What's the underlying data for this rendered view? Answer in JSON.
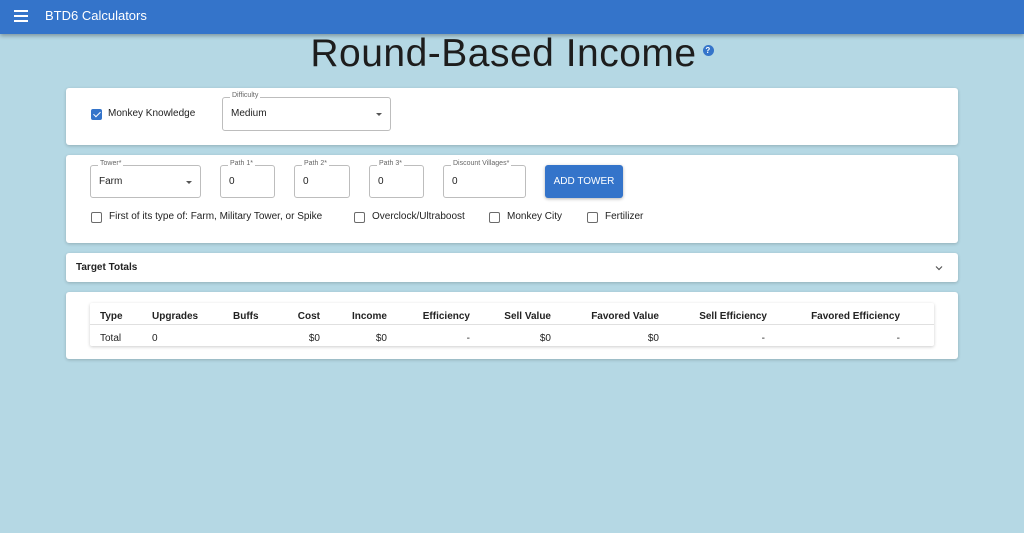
{
  "appbar": {
    "title": "BTD6 Calculators"
  },
  "page": {
    "title": "Round-Based Income",
    "help_icon": "?"
  },
  "settings": {
    "monkey_knowledge": {
      "label": "Monkey Knowledge",
      "checked": true
    },
    "difficulty": {
      "label": "Difficulty",
      "value": "Medium"
    }
  },
  "tower_form": {
    "tower": {
      "label": "Tower",
      "required": "*",
      "value": "Farm"
    },
    "path1": {
      "label": "Path 1",
      "required": "*",
      "value": "0"
    },
    "path2": {
      "label": "Path 2",
      "required": "*",
      "value": "0"
    },
    "path3": {
      "label": "Path 3",
      "required": "*",
      "value": "0"
    },
    "discount_villages": {
      "label": "Discount Villages",
      "required": "*",
      "value": "0"
    },
    "add_button": "ADD TOWER",
    "checkboxes": [
      {
        "label": "First of its type of: Farm, Military Tower, or Spike",
        "checked": false
      },
      {
        "label": "Overclock/Ultraboost",
        "checked": false
      },
      {
        "label": "Monkey City",
        "checked": false
      },
      {
        "label": "Fertilizer",
        "checked": false
      }
    ]
  },
  "target_totals": {
    "title": "Target Totals"
  },
  "table": {
    "headers": [
      "Type",
      "Upgrades",
      "Buffs",
      "Cost",
      "Income",
      "Efficiency",
      "Sell Value",
      "Favored Value",
      "Sell Efficiency",
      "Favored Efficiency"
    ],
    "rows": [
      [
        "Total",
        "0",
        "",
        "$0",
        "$0",
        "-",
        "$0",
        "$0",
        "-",
        "-"
      ]
    ]
  },
  "colors": {
    "primary": "#3474ca",
    "background": "#b5d8e4"
  },
  "icons": {
    "menu": "menu-icon",
    "help": "help-icon",
    "expand": "expand-more-icon",
    "dropdown": "dropdown-caret-icon",
    "check": "check-icon"
  }
}
